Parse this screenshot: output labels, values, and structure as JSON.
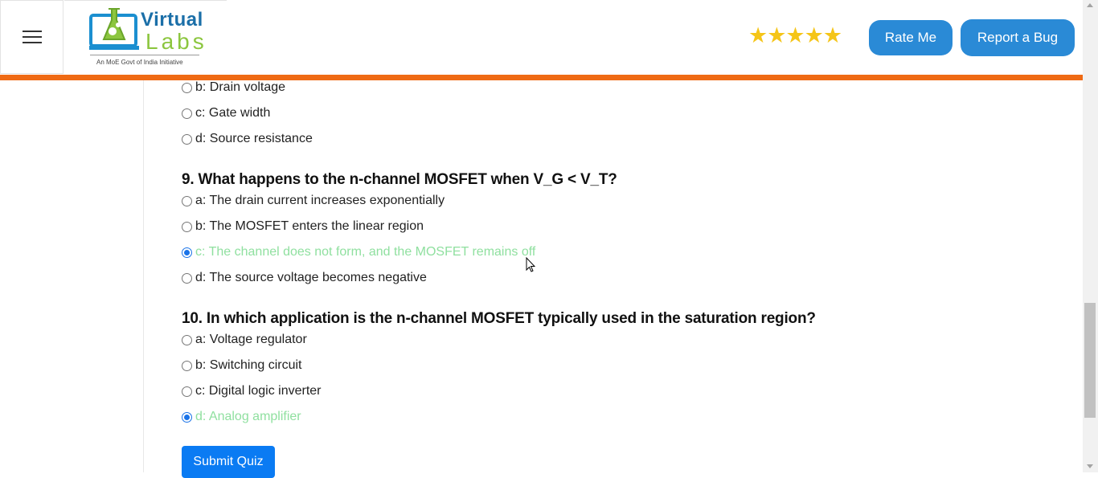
{
  "header": {
    "logo": {
      "word1": "Virtual",
      "word2": "Labs",
      "tagline": "An MoE Govt of India Initiative"
    },
    "rating": {
      "stars": 5,
      "display": "★★★★★"
    },
    "rate_me_label": "Rate Me",
    "report_bug_label": "Report a Bug"
  },
  "colors": {
    "accent_orange": "#ef6a14",
    "button_blue": "#2a8ad6",
    "submit_blue": "#0a7bf3",
    "selected_text": "#90e0a0"
  },
  "quiz": {
    "q8_partial_options": [
      {
        "label": "b: Drain voltage",
        "selected": false
      },
      {
        "label": "c: Gate width",
        "selected": false
      },
      {
        "label": "d: Source resistance",
        "selected": false
      }
    ],
    "q9": {
      "question": "9. What happens to the n-channel MOSFET when V_G < V_T?",
      "options": [
        {
          "label": "a: The drain current increases exponentially",
          "selected": false
        },
        {
          "label": "b: The MOSFET enters the linear region",
          "selected": false
        },
        {
          "label": "c: The channel does not form, and the MOSFET remains off",
          "selected": true
        },
        {
          "label": "d: The source voltage becomes negative",
          "selected": false
        }
      ]
    },
    "q10": {
      "question": "10. In which application is the n-channel MOSFET typically used in the saturation region?",
      "options": [
        {
          "label": "a: Voltage regulator",
          "selected": false
        },
        {
          "label": "b: Switching circuit",
          "selected": false
        },
        {
          "label": "c: Digital logic inverter",
          "selected": false
        },
        {
          "label": "d: Analog amplifier",
          "selected": true
        }
      ]
    },
    "submit_label": "Submit Quiz"
  }
}
